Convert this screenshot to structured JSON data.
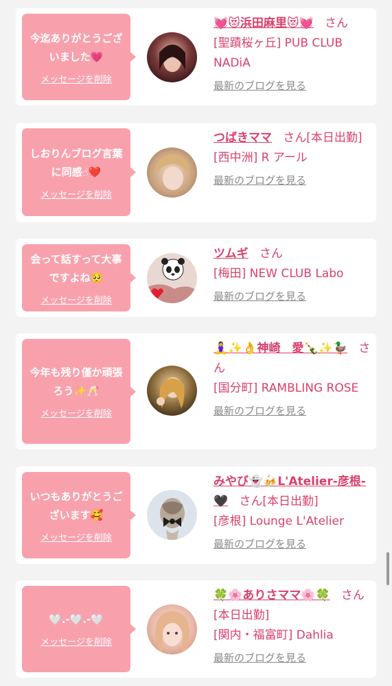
{
  "delete_label": "メッセージを削除",
  "blog_label": "最新のブログを見る",
  "accent_color": "#d9416c",
  "bubble_color": "#f8a1ad",
  "items": [
    {
      "message": "今迄ありがとうございました💗",
      "name": "💓😻浜田麻里😻💓",
      "suffix": "さん",
      "shop": "[聖蹟桜ヶ丘] PUB CLUB NADiA"
    },
    {
      "message": "しおりんブログ言葉に同感☝❤️",
      "name": "つばきママ",
      "suffix": "さん[本日出勤]",
      "shop": "[西中洲] R アール"
    },
    {
      "message": "会って話すって大事ですよね🥺",
      "name": "ツムギ",
      "suffix": "さん",
      "shop": "[梅田] NEW CLUB Labo"
    },
    {
      "message": "今年も残り僅か頑張ろう✨🥂",
      "name": "🧘‍♀️✨👌神崎　愛🍾✨🦆",
      "suffix": "さん",
      "shop": "[国分町] RAMBLING ROSE"
    },
    {
      "message": "いつもありがとうございます🥰",
      "name": "みやび👻🍻L'Atelier-彦根-🖤",
      "suffix": "さん[本日出勤]",
      "shop": "[彦根] Lounge L'Atelier"
    },
    {
      "message": "🤍.-🤍.-🤍",
      "name": "🍀🌸ありさママ🌸🍀",
      "suffix": "さん[本日出勤]",
      "shop": "[関内・福富町] Dahlia"
    }
  ]
}
